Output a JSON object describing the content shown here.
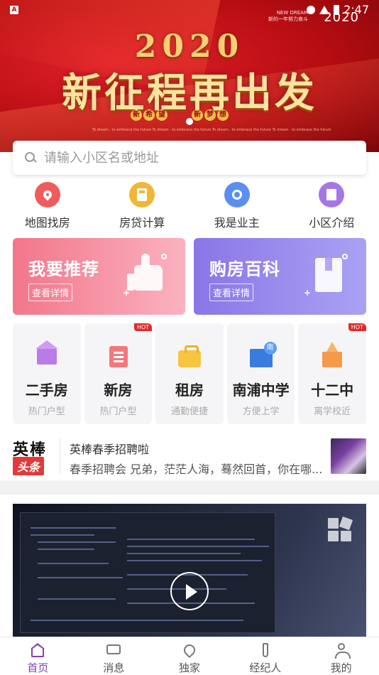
{
  "status_bar": {
    "time": "2:47"
  },
  "banner": {
    "brand_line_1": "NEW DREAM",
    "brand_line_2": "新的一年努力奋斗",
    "year_small": "2020",
    "year_big": "2020",
    "slogan": "新征程再出发",
    "chips_left": [
      "新",
      "希",
      "望"
    ],
    "chips_right": [
      "新",
      "梦",
      "想"
    ],
    "fine_print": "To dream · to embrace the future To dream · to embrace the future To dream · to embrace the future To dream · to embrace the future"
  },
  "search": {
    "placeholder": "请输入小区名或地址"
  },
  "quick_actions": [
    {
      "label": "地图找房",
      "icon": "map-pin-icon",
      "color": "#f05b5b"
    },
    {
      "label": "房贷计算",
      "icon": "calculator-icon",
      "color": "#f3b536"
    },
    {
      "label": "我是业主",
      "icon": "key-icon",
      "color": "#5b8ef2"
    },
    {
      "label": "小区介绍",
      "icon": "building-icon",
      "color": "#a577e6"
    }
  ],
  "promos": [
    {
      "title": "我要推荐",
      "button": "查看详情",
      "icon": "thumbs-up-icon"
    },
    {
      "title": "购房百科",
      "button": "查看详情",
      "icon": "book-icon"
    }
  ],
  "categories": [
    {
      "title": "二手房",
      "subtitle": "热门户型",
      "hot": "",
      "icon": "house-icon"
    },
    {
      "title": "新房",
      "subtitle": "热门户型",
      "hot": "HOT",
      "icon": "document-icon"
    },
    {
      "title": "租房",
      "subtitle": "通勤便捷",
      "hot": "",
      "icon": "suitcase-icon"
    },
    {
      "title": "南浦中学",
      "subtitle": "方便上学",
      "hot": "",
      "icon": "school-building-icon"
    },
    {
      "title": "十二中",
      "subtitle": "离学校近",
      "hot": "HOT",
      "icon": "castle-school-icon"
    }
  ],
  "news": {
    "logo_top": "英棒",
    "logo_bottom": "头条",
    "title": "英棒春季招聘啦",
    "text": "春季招聘会 兄弟，茫茫人海，蓦然回首，你在哪..."
  },
  "tabs": [
    {
      "label": "首页",
      "icon": "home-icon",
      "active": true
    },
    {
      "label": "消息",
      "icon": "message-icon",
      "active": false
    },
    {
      "label": "独家",
      "icon": "heart-icon",
      "active": false
    },
    {
      "label": "经纪人",
      "icon": "tie-icon",
      "active": false
    },
    {
      "label": "我的",
      "icon": "user-icon",
      "active": false
    }
  ],
  "colors": {
    "accent": "#8a3fb3",
    "banner_red": "#c8141b",
    "hot": "#e22a2a"
  }
}
